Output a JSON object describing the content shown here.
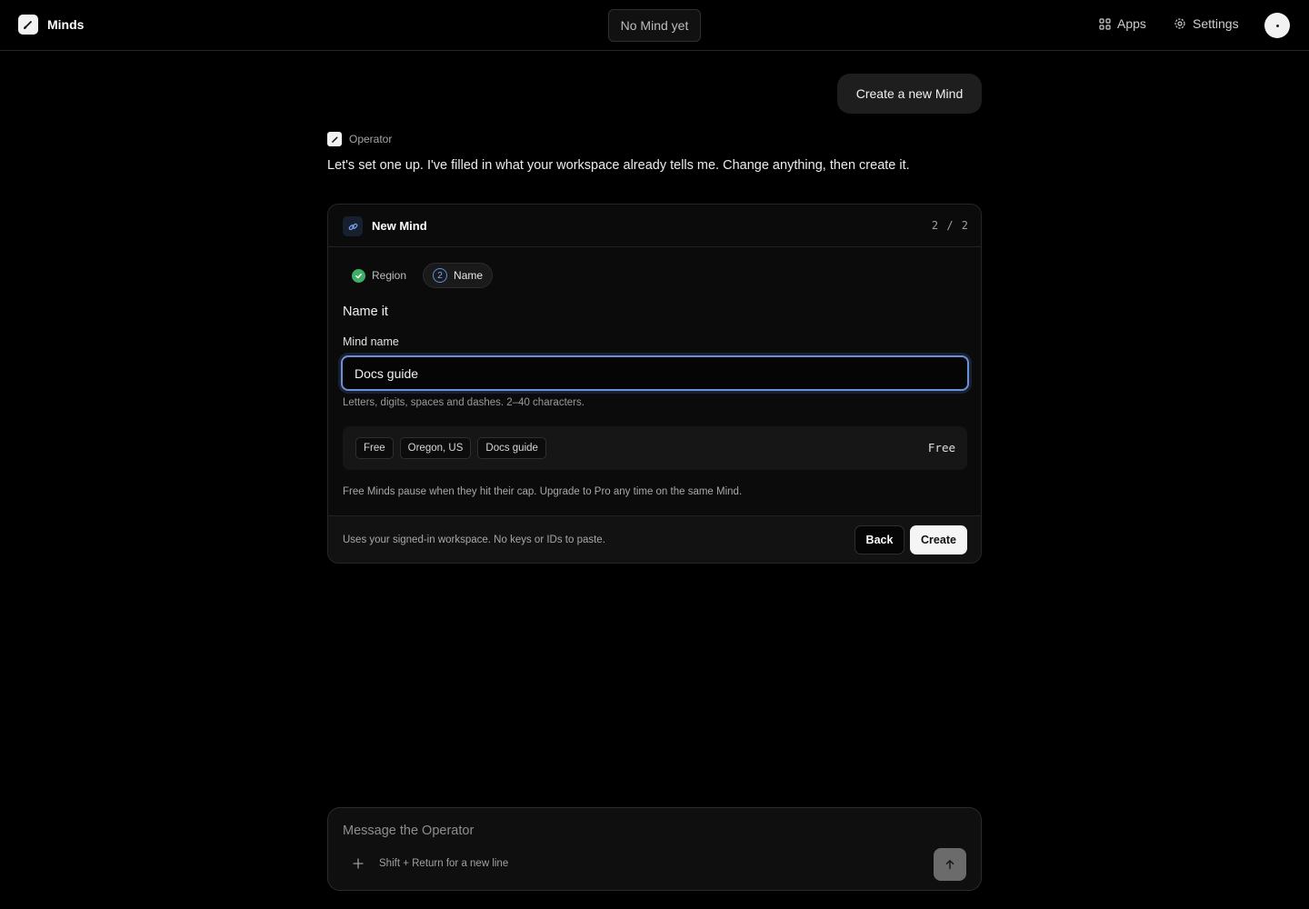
{
  "app": {
    "name": "Minds"
  },
  "header": {
    "mind_selector": "No Mind yet",
    "nav": {
      "apps": "Apps",
      "settings": "Settings"
    }
  },
  "chat": {
    "user_message": "Create a new Mind",
    "operator": {
      "name": "Operator",
      "message": "Let's set one up. I've filled in what your workspace already tells me. Change anything, then create it."
    }
  },
  "card": {
    "title": "New Mind",
    "step_indicator": "2 / 2",
    "steps": [
      {
        "label": "Region",
        "status": "done"
      },
      {
        "number": "2",
        "label": "Name",
        "status": "active"
      }
    ],
    "section_title": "Name it",
    "field": {
      "label": "Mind name",
      "value": "Docs guide",
      "hint": "Letters, digits, spaces and dashes. 2–40 characters."
    },
    "summary": {
      "chips": [
        "Free",
        "Oregon, US",
        "Docs guide"
      ],
      "plan_price": "Free"
    },
    "note": "Free Minds pause when they hit their cap. Upgrade to Pro any time on the same Mind.",
    "footer": {
      "text": "Uses your signed-in workspace. No keys or IDs to paste.",
      "back_label": "Back",
      "create_label": "Create"
    }
  },
  "composer": {
    "placeholder": "Message the Operator",
    "hint": "Shift + Return for a new line"
  },
  "colors": {
    "background": "#000000",
    "surface": "#0b0b0b",
    "focus_ring": "#6d8fd8",
    "success": "#3fae67",
    "accent_blue": "#7aa7f0"
  },
  "icons": {
    "brand": "pen-icon",
    "apps": "apps-grid-icon",
    "settings": "gear-icon",
    "card": "link-icon",
    "step_done": "check-icon",
    "attach": "plus-icon",
    "send": "arrow-up-icon"
  }
}
